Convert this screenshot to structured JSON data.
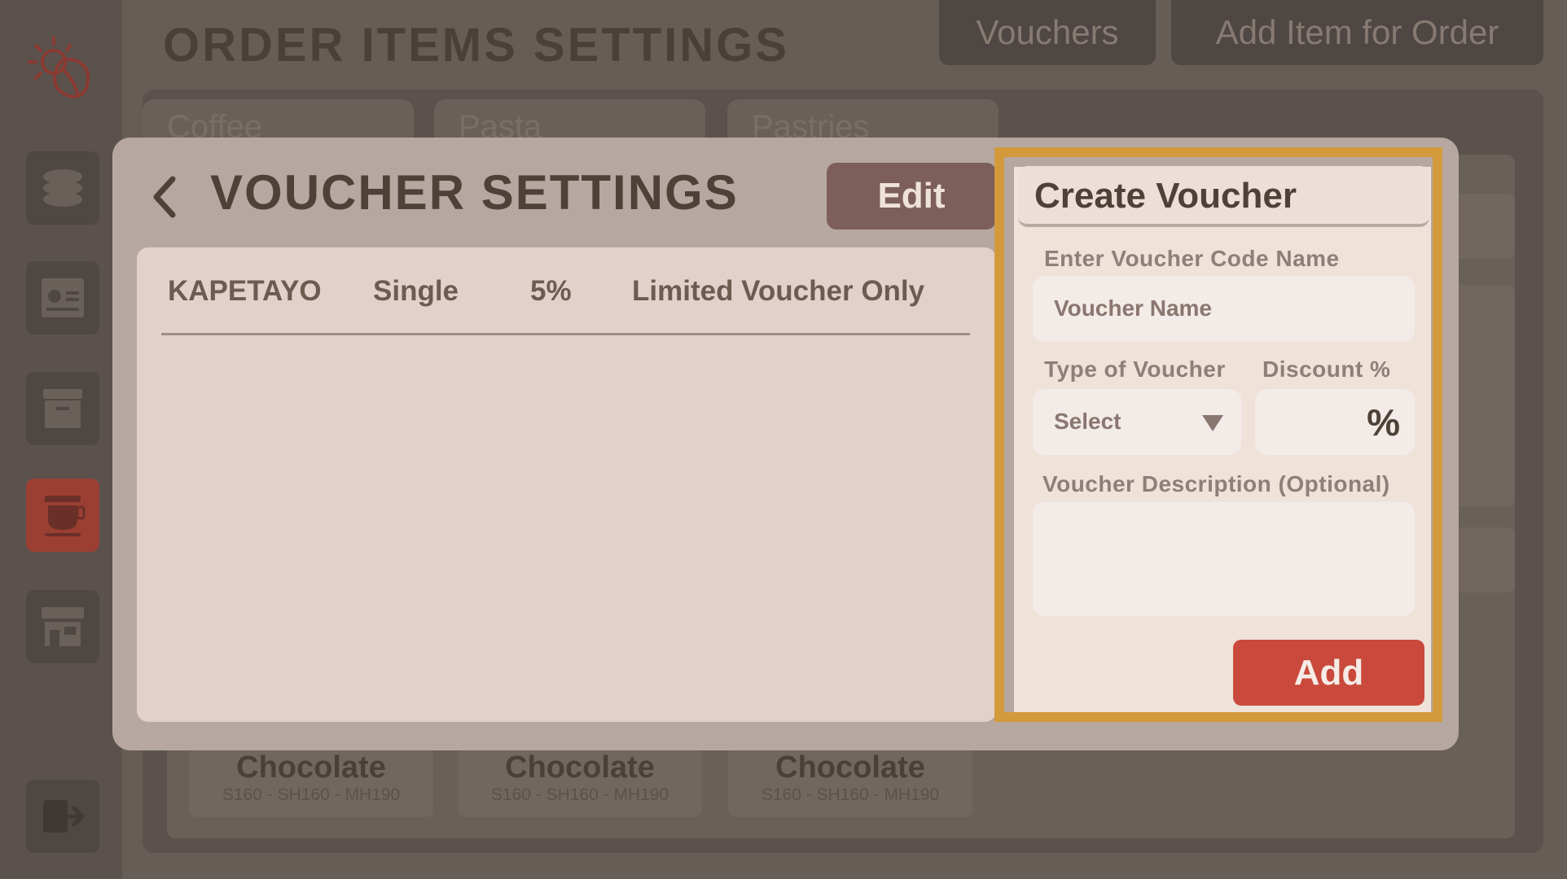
{
  "page": {
    "title": "ORDER ITEMS SETTINGS",
    "top_buttons": {
      "vouchers": "Vouchers",
      "add_item": "Add Item for Order"
    },
    "category_tabs": [
      "Coffee",
      "Pasta",
      "Pastries"
    ],
    "item_cards": [
      {
        "name": "Chocolate",
        "prices": "S160 - SH160 - MH190"
      },
      {
        "name": "Chocolate",
        "prices": "S160 - SH160 - MH190"
      },
      {
        "name": "Chocolate",
        "prices": "S160 - SH160 - MH190"
      }
    ]
  },
  "sidebar": {
    "items": [
      {
        "icon": "coins-icon",
        "active": false
      },
      {
        "icon": "report-icon",
        "active": false
      },
      {
        "icon": "archive-icon",
        "active": false
      },
      {
        "icon": "coffee-cup-icon",
        "active": true
      },
      {
        "icon": "store-icon",
        "active": false
      }
    ],
    "logout_icon": "logout-icon"
  },
  "modal": {
    "title": "VOUCHER SETTINGS",
    "edit_label": "Edit",
    "voucher_row": {
      "code": "KAPETAYO",
      "type": "Single",
      "discount": "5%",
      "description": "Limited Voucher Only"
    }
  },
  "create_voucher": {
    "title": "Create Voucher",
    "code_label": "Enter Voucher Code Name",
    "code_placeholder": "Voucher Name",
    "type_label": "Type of Voucher",
    "type_value": "Select",
    "discount_label": "Discount %",
    "discount_suffix": "%",
    "description_label": "Voucher Description (Optional)",
    "add_label": "Add"
  },
  "colors": {
    "accent_highlight": "#d39a3c",
    "add_button": "#c94a3c",
    "active_nav": "#9b3f33"
  }
}
